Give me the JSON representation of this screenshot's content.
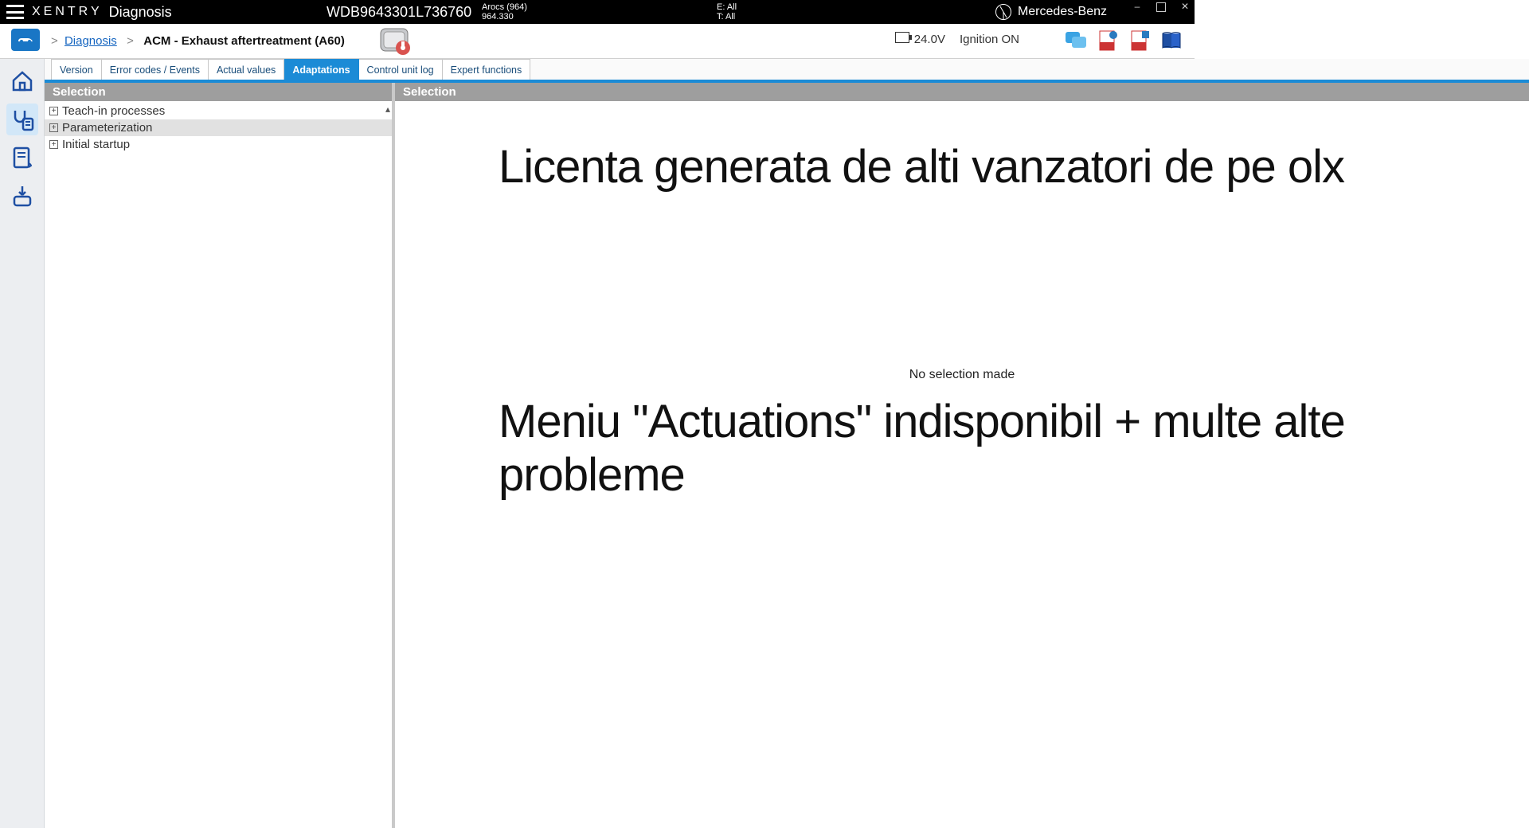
{
  "topbar": {
    "brand": "XENTRY",
    "sub": "Diagnosis",
    "vin": "WDB9643301L736760",
    "vehicle_line1": "Arocs (964)",
    "vehicle_line2": "964.330",
    "e_info": "E: All",
    "t_info": "T: All",
    "mb_brand": "Mercedes-Benz"
  },
  "crumbs": {
    "link": "Diagnosis",
    "current": "ACM - Exhaust aftertreatment (A60)"
  },
  "status": {
    "voltage": "24.0V",
    "ignition": "Ignition ON"
  },
  "tabs": [
    {
      "label": "Version",
      "active": false
    },
    {
      "label": "Error codes / Events",
      "active": false
    },
    {
      "label": "Actual values",
      "active": false
    },
    {
      "label": "Adaptations",
      "active": true
    },
    {
      "label": "Control unit log",
      "active": false
    },
    {
      "label": "Expert functions",
      "active": false
    }
  ],
  "left": {
    "header": "Selection",
    "items": [
      {
        "label": "Teach-in processes",
        "selected": false
      },
      {
        "label": "Parameterization",
        "selected": true
      },
      {
        "label": "Initial startup",
        "selected": false
      }
    ]
  },
  "right": {
    "header": "Selection",
    "no_selection": "No selection made",
    "overlay_top": "Licenta generata de alti vanzatori de pe olx",
    "overlay_bottom": "Meniu \"Actuations\" indisponibil + multe alte probleme"
  }
}
